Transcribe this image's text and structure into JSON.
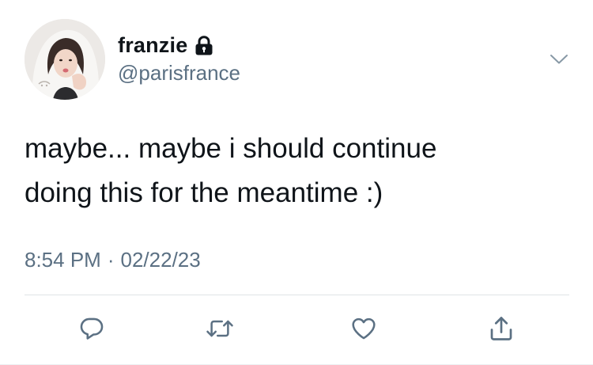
{
  "profile": {
    "display_name": "franzie",
    "handle": "@parisfrance",
    "protected_icon": "lock-icon",
    "avatar_icon": "profile-photo"
  },
  "menu": {
    "icon": "chevron-down-icon"
  },
  "tweet": {
    "lines": [
      "maybe... maybe i should continue",
      "doing this for the meantime :)"
    ],
    "time": "8:54 PM",
    "separator": "·",
    "date": "02/22/23"
  },
  "actions": [
    {
      "icon": "reply-icon"
    },
    {
      "icon": "retweet-icon"
    },
    {
      "icon": "like-icon"
    },
    {
      "icon": "share-icon"
    }
  ],
  "colors": {
    "text": "#0f1419",
    "secondary": "#5b7083",
    "divider": "#dfe3e6",
    "icon": "#5b7083"
  }
}
